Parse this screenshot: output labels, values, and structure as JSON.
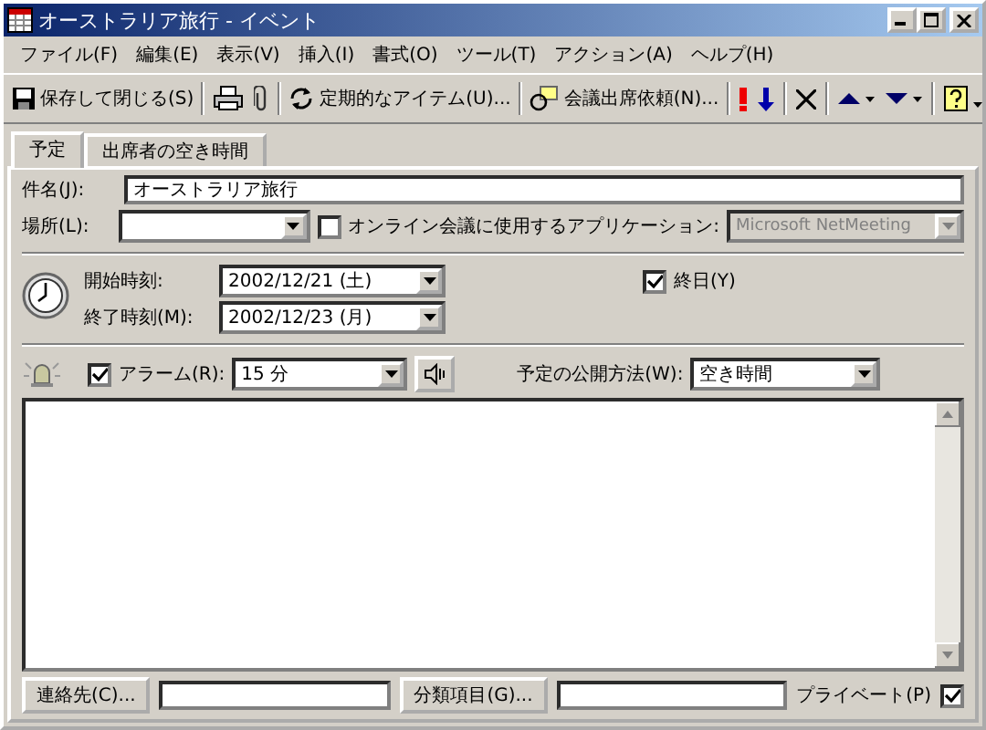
{
  "window": {
    "title": "オーストラリア旅行 - イベント"
  },
  "menu": [
    "ファイル(F)",
    "編集(E)",
    "表示(V)",
    "挿入(I)",
    "書式(O)",
    "ツール(T)",
    "アクション(A)",
    "ヘルプ(H)"
  ],
  "toolbar": [
    {
      "kind": "save",
      "label": "保存して閉じる(S)"
    },
    {
      "kind": "print"
    },
    {
      "kind": "attach"
    },
    {
      "kind": "recur",
      "label": "定期的なアイテム(U)..."
    },
    {
      "kind": "invite",
      "label": "会議出席依頼(N)..."
    },
    {
      "kind": "high"
    },
    {
      "kind": "low"
    },
    {
      "kind": "delete"
    },
    {
      "kind": "prev"
    },
    {
      "kind": "next"
    },
    {
      "kind": "help"
    }
  ],
  "tabs": [
    {
      "label": "予定",
      "selected": true
    },
    {
      "label": "出席者の空き時間",
      "selected": false
    }
  ],
  "subject": {
    "label": "件名(J):",
    "value": "オーストラリア旅行"
  },
  "location": {
    "label": "場所(L):"
  },
  "online_meeting": {
    "label": "オンライン会議に使用するアプリケーション:",
    "checked": false,
    "app": "Microsoft NetMeeting",
    "disabled": true
  },
  "start": {
    "label": "開始時刻:",
    "value": "2002/12/21 (土)"
  },
  "end": {
    "label": "終了時刻(M):",
    "value": "2002/12/23 (月)"
  },
  "all_day": {
    "label": "終日(Y)",
    "checked": true
  },
  "reminder": {
    "label": "アラーム(R):",
    "checked": true,
    "value": "15 分"
  },
  "show_as": {
    "label": "予定の公開方法(W):",
    "value": "空き時間"
  },
  "footer": {
    "contacts_button": "連絡先(C)...",
    "categories_button": "分類項目(G)...",
    "private": {
      "label": "プライベート(P)",
      "checked": true
    }
  }
}
